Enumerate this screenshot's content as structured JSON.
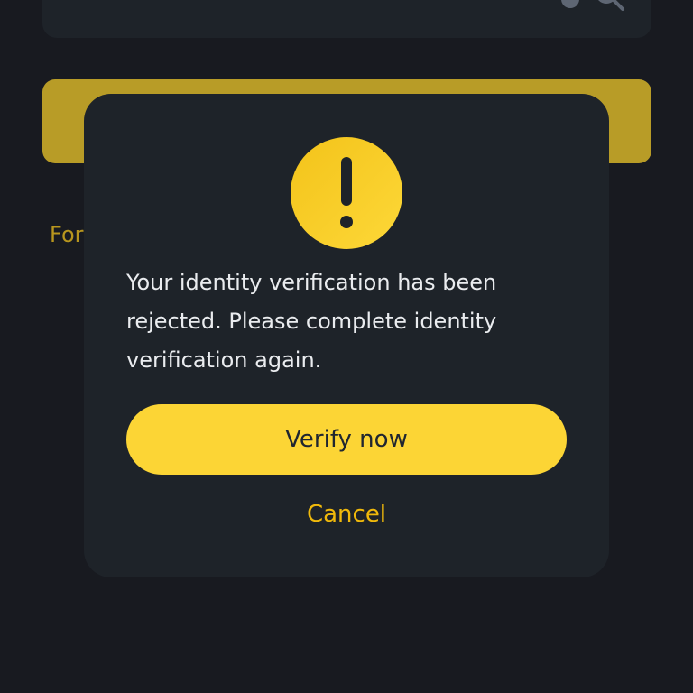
{
  "background": {
    "forgot_link_partial": "For",
    "icon_names": [
      "eye-icon",
      "clear-icon"
    ]
  },
  "dialog": {
    "icon": "warning-icon",
    "message": "Your identity verification has been rejected. Please complete identity verification again.",
    "primary_button_label": "Verify now",
    "cancel_label": "Cancel"
  },
  "colors": {
    "background": "#181a20",
    "surface": "#1e2329",
    "accent": "#fcd535",
    "accent_text": "#f0b90b",
    "text_primary": "#eaecef"
  }
}
